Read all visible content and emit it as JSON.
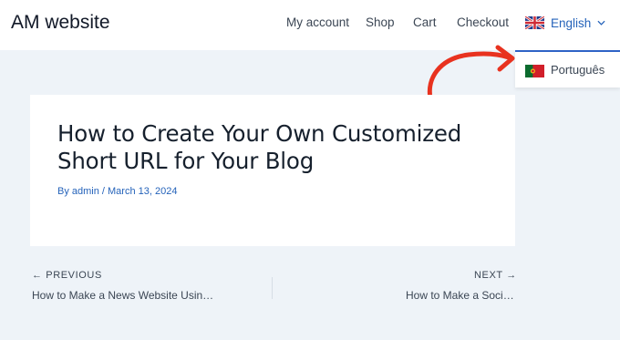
{
  "header": {
    "site_title": "AM website",
    "nav": [
      {
        "label": "My account"
      },
      {
        "label": "Shop"
      },
      {
        "label": "Cart"
      },
      {
        "label": "Checkout"
      }
    ],
    "language": {
      "current": "English",
      "icon": "uk-flag-icon"
    }
  },
  "language_dropdown": {
    "items": [
      {
        "label": "Português",
        "icon": "portugal-flag-icon"
      }
    ]
  },
  "annotation": {
    "icon": "curved-arrow-icon",
    "color": "#e8321f"
  },
  "post": {
    "title": "How to Create Your Own Customized Short URL for Your Blog",
    "meta": "By admin / March 13, 2024"
  },
  "post_navigation": {
    "previous": {
      "label": "← PREVIOUS",
      "title": "How to Make a News Website Usin…"
    },
    "next": {
      "label": "NEXT →",
      "title": "How to Make a Soci…"
    }
  },
  "colors": {
    "accent": "#2563ba",
    "background": "#eef3f8",
    "dropdown_border": "#2e63c6"
  }
}
